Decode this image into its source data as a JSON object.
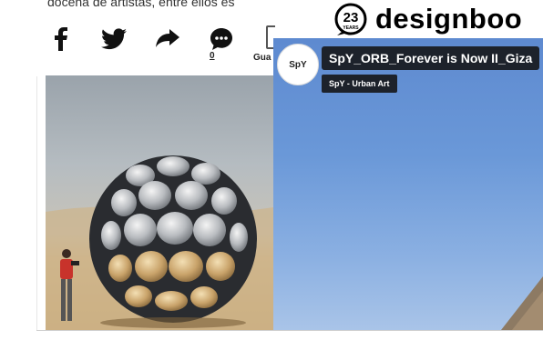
{
  "article": {
    "text": "docena de artistas, entre ellos es"
  },
  "share": {
    "comment_count": "0",
    "save_label": "Gua"
  },
  "header": {
    "badge_number": "23",
    "badge_text": "YEARS",
    "logo_text": "designboo"
  },
  "embed": {
    "avatar": "SpY",
    "title": "SpY_ORB_Forever is Now II_Giza",
    "subtitle": "SpY - Urban Art"
  }
}
